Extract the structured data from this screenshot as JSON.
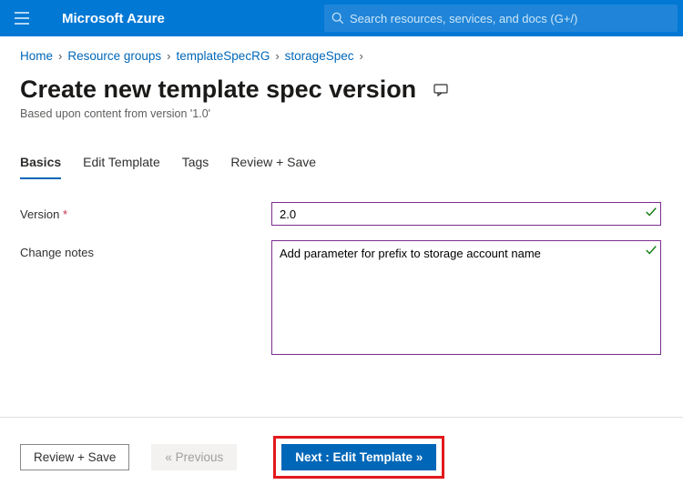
{
  "header": {
    "brand": "Microsoft Azure",
    "search_placeholder": "Search resources, services, and docs (G+/)"
  },
  "breadcrumb": {
    "items": [
      "Home",
      "Resource groups",
      "templateSpecRG",
      "storageSpec"
    ]
  },
  "page": {
    "title": "Create new template spec version",
    "subtitle": "Based upon content from version '1.0'"
  },
  "tabs": {
    "items": [
      "Basics",
      "Edit Template",
      "Tags",
      "Review + Save"
    ],
    "active": 0
  },
  "form": {
    "version_label": "Version",
    "version_value": "2.0",
    "notes_label": "Change notes",
    "notes_value": "Add parameter for prefix to storage account name"
  },
  "footer": {
    "review": "Review + Save",
    "previous": "« Previous",
    "next": "Next : Edit Template »"
  }
}
